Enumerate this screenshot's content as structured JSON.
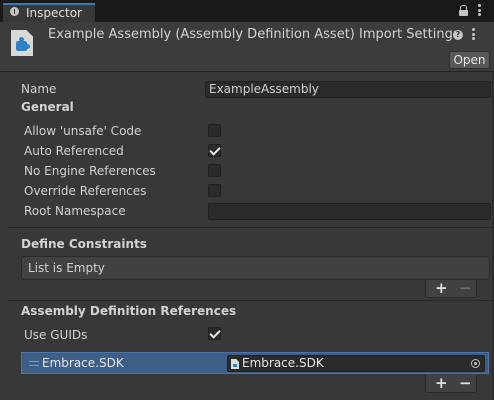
{
  "tab": {
    "label": "Inspector",
    "icon": "info-icon"
  },
  "header": {
    "title": "Example Assembly (Assembly Definition Asset) Import Settings",
    "open_label": "Open"
  },
  "name_field": {
    "label": "Name",
    "value": "ExampleAssembly"
  },
  "general": {
    "title": "General",
    "options": [
      {
        "label": "Allow 'unsafe' Code",
        "checked": false
      },
      {
        "label": "Auto Referenced",
        "checked": true
      },
      {
        "label": "No Engine References",
        "checked": false
      },
      {
        "label": "Override References",
        "checked": false
      }
    ],
    "root_namespace": {
      "label": "Root Namespace",
      "value": ""
    }
  },
  "define_constraints": {
    "title": "Define Constraints",
    "empty_text": "List is Empty",
    "add_label": "+",
    "remove_label": "−"
  },
  "assembly_refs": {
    "title": "Assembly Definition References",
    "use_guids": {
      "label": "Use GUIDs",
      "checked": true
    },
    "items": [
      {
        "name": "Embrace.SDK",
        "reference": "Embrace.SDK"
      }
    ],
    "add_label": "+",
    "remove_label": "−"
  },
  "colors": {
    "background": "#383838",
    "selection": "#3d5f87",
    "accent": "#3a79bb"
  }
}
